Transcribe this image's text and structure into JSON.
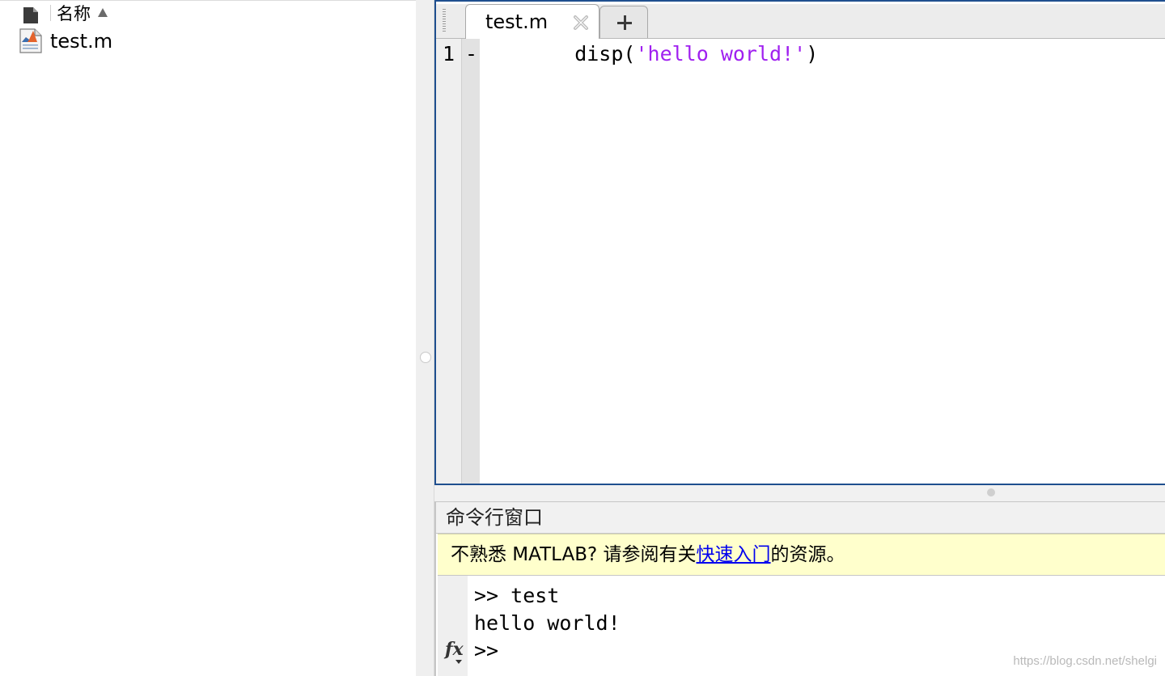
{
  "file_browser": {
    "column_header": "名称",
    "files": [
      {
        "name": "test.m",
        "icon": "matlab-file-icon"
      }
    ]
  },
  "editor": {
    "tabs": [
      {
        "label": "test.m",
        "active": true
      }
    ],
    "add_tab_icon": "plus-icon",
    "lines": [
      {
        "number": "1",
        "marker": "-",
        "code_before": "    disp(",
        "code_string": "'hello world!'",
        "code_after": ")"
      }
    ]
  },
  "command_window": {
    "title": "命令行窗口",
    "banner": {
      "text_before": "不熟悉 MATLAB? 请参阅有关",
      "link_text": "快速入门",
      "text_after": "的资源。"
    },
    "lines": [
      ">> test",
      "hello world!",
      ">>"
    ],
    "fx_icon": "fx"
  },
  "watermark": "https://blog.csdn.net/shelgi",
  "colors": {
    "editor_border": "#1f4f8f",
    "string_literal": "#a020f0",
    "banner_bg": "#ffffcc",
    "link": "#0000ee"
  }
}
